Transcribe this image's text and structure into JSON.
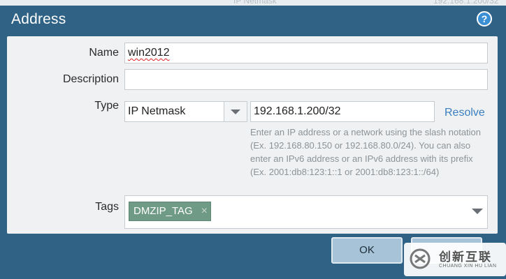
{
  "background_table": {
    "snippet_left": "IP Netmask",
    "snippet_right": "192.168.1.200/32"
  },
  "dialog": {
    "title": "Address",
    "help_icon": "question-circle-icon"
  },
  "form": {
    "name": {
      "label": "Name",
      "value": "win2012"
    },
    "description": {
      "label": "Description",
      "value": ""
    },
    "type": {
      "label": "Type",
      "selected": "IP Netmask",
      "value": "192.168.1.200/32",
      "resolve_link": "Resolve",
      "hint": "Enter an IP address or a network using the slash notation (Ex. 192.168.80.150 or 192.168.80.0/24). You can also enter an IPv6 address or an IPv6 address with its prefix (Ex. 2001:db8:123:1::1 or 2001:db8:123:1::/64)"
    },
    "tags": {
      "label": "Tags",
      "items": [
        "DMZIP_TAG"
      ],
      "remove_glyph": "×"
    }
  },
  "buttons": {
    "ok": "OK"
  },
  "watermark": {
    "text_cn": "创新互联",
    "text_en": "CHUANG XIN HU LIAN"
  },
  "colors": {
    "dialog_bg": "#2f6285",
    "panel_bg": "#eff1f2",
    "link": "#3a7fc1",
    "tag_bg": "#6f9a86",
    "button_bg": "#a7c3d7"
  }
}
